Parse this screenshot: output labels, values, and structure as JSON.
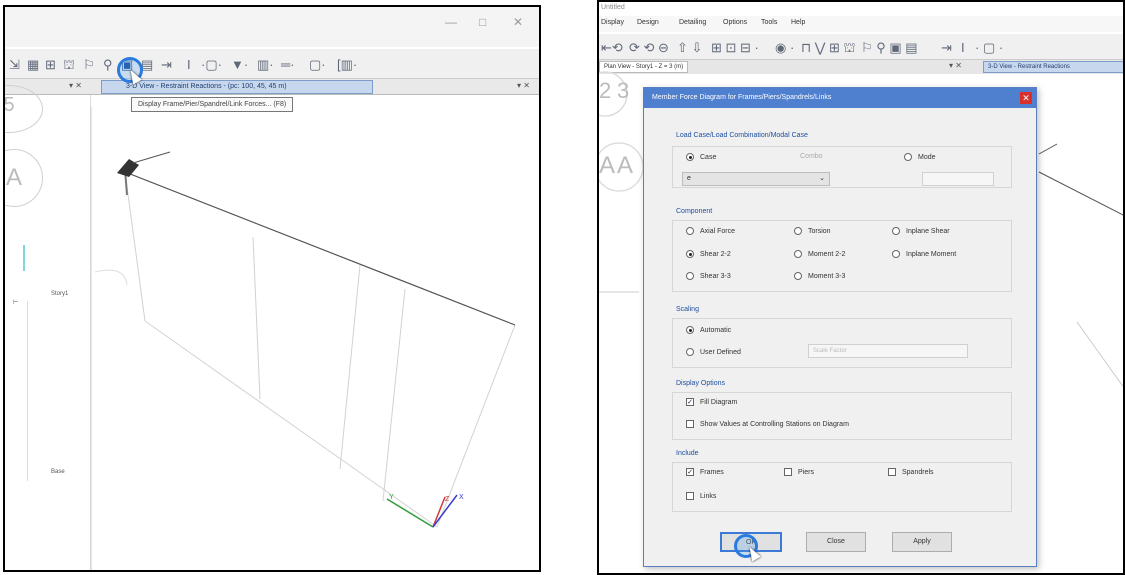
{
  "left": {
    "window_controls": [
      "—",
      "□",
      "✕"
    ],
    "tab": {
      "label": "3-D View - Restraint Reactions - (pc: 100, 45, 45 m)"
    },
    "tooltip": "Display Frame/Pier/Spandrel/Link Forces... (F8)",
    "grid_bubbles": [
      "5",
      "A"
    ],
    "story_labels": [
      "Story1",
      "Base"
    ]
  },
  "right": {
    "app_title": "Untitled",
    "menu": [
      "Display",
      "Design",
      "Detailing",
      "Options",
      "Tools",
      "Help"
    ],
    "tabs": {
      "left": "Plan View - Story1 - Z = 3 (m)",
      "right": "3-D View - Restraint Reactions"
    },
    "bubbles": [
      "2",
      "3",
      "A",
      "A"
    ],
    "dialog": {
      "title": "Member Force Diagram for Frames/Piers/Spandrels/Links",
      "load_case_group": {
        "label": "Load Case/Load Combination/Modal Case",
        "options": [
          {
            "label": "Case",
            "selected": true,
            "enabled": true
          },
          {
            "label": "Combo",
            "selected": false,
            "enabled": false
          },
          {
            "label": "Mode",
            "selected": false,
            "enabled": true
          }
        ],
        "case_value": "e"
      },
      "component_group": {
        "label": "Component",
        "options": [
          {
            "label": "Axial Force",
            "selected": false
          },
          {
            "label": "Torsion",
            "selected": false
          },
          {
            "label": "Inplane Shear",
            "selected": false
          },
          {
            "label": "Shear 2-2",
            "selected": true
          },
          {
            "label": "Moment 2-2",
            "selected": false
          },
          {
            "label": "Inplane Moment",
            "selected": false
          },
          {
            "label": "Shear 3-3",
            "selected": false
          },
          {
            "label": "Moment 3-3",
            "selected": false
          }
        ]
      },
      "scaling_group": {
        "label": "Scaling",
        "options": [
          {
            "label": "Automatic",
            "selected": true
          },
          {
            "label": "User Defined",
            "selected": false
          }
        ],
        "scale_factor_label": "Scale Factor"
      },
      "display_group": {
        "label": "Display Options",
        "options": [
          {
            "label": "Fill Diagram",
            "checked": true
          },
          {
            "label": "Show Values at Controlling Stations on Diagram",
            "checked": false
          }
        ]
      },
      "include_group": {
        "label": "Include",
        "options": [
          {
            "label": "Frames",
            "checked": true
          },
          {
            "label": "Piers",
            "checked": false
          },
          {
            "label": "Spandrels",
            "checked": false
          },
          {
            "label": "Links",
            "checked": false
          }
        ]
      },
      "buttons": {
        "ok": "OK",
        "close": "Close",
        "apply": "Apply"
      }
    }
  },
  "colors": {
    "accent": "#2a7be0",
    "dialog_title": "#4f7fcf",
    "close": "#d9302c"
  }
}
